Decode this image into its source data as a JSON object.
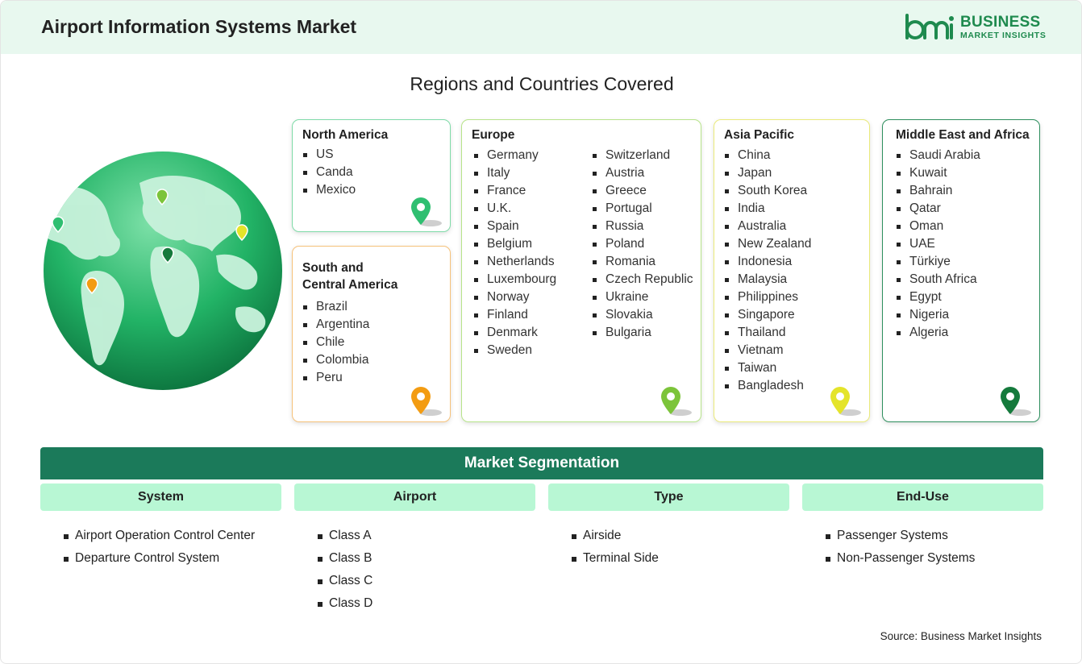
{
  "header": {
    "title": "Airport Information Systems Market",
    "logo": {
      "line1": "BUSINESS",
      "line2": "MARKET INSIGHTS"
    }
  },
  "regions_title": "Regions and Countries Covered",
  "regions": {
    "north_america": {
      "title": "North America",
      "items": [
        "US",
        "Canda",
        "Mexico"
      ],
      "pin_color": "#2fbf71"
    },
    "south_america": {
      "title_line1": "South and",
      "title_line2": "Central America",
      "items": [
        "Brazil",
        "Argentina",
        "Chile",
        "Colombia",
        "Peru"
      ],
      "pin_color": "#f39c12"
    },
    "europe": {
      "title": "Europe",
      "col1": [
        "Germany",
        "Italy",
        "France",
        "U.K.",
        "Spain",
        "Belgium",
        "Netherlands",
        "Luxembourg",
        "Norway",
        "Finland",
        "Denmark",
        "Sweden"
      ],
      "col2": [
        "Switzerland",
        "Austria",
        "Greece",
        "Portugal",
        "Russia",
        "Poland",
        "Romania",
        "Czech Republic",
        "Ukraine",
        "Slovakia",
        "Bulgaria"
      ],
      "pin_color": "#7cc43a"
    },
    "asia_pacific": {
      "title": "Asia Pacific",
      "items": [
        "China",
        "Japan",
        "South Korea",
        "India",
        "Australia",
        "New Zealand",
        "Indonesia",
        "Malaysia",
        "Philippines",
        "Singapore",
        "Thailand",
        "Vietnam",
        "Taiwan",
        "Bangladesh"
      ],
      "pin_color": "#e4e42a"
    },
    "mea": {
      "title": "Middle East and Africa",
      "items": [
        "Saudi Arabia",
        "Kuwait",
        "Bahrain",
        "Qatar",
        "Oman",
        "UAE",
        "Türkiye",
        "South Africa",
        "Egypt",
        "Nigeria",
        "Algeria"
      ],
      "pin_color": "#157a3c"
    }
  },
  "segmentation": {
    "title": "Market Segmentation",
    "columns": [
      {
        "head": "System",
        "items": [
          "Airport Operation Control Center",
          "Departure Control System"
        ]
      },
      {
        "head": "Airport",
        "items": [
          "Class A",
          "Class B",
          "Class C",
          "Class D"
        ]
      },
      {
        "head": "Type",
        "items": [
          "Airside",
          "Terminal Side"
        ]
      },
      {
        "head": "End-Use",
        "items": [
          "Passenger Systems",
          "Non-Passenger Systems"
        ]
      }
    ]
  },
  "source": "Source: Business Market Insights"
}
